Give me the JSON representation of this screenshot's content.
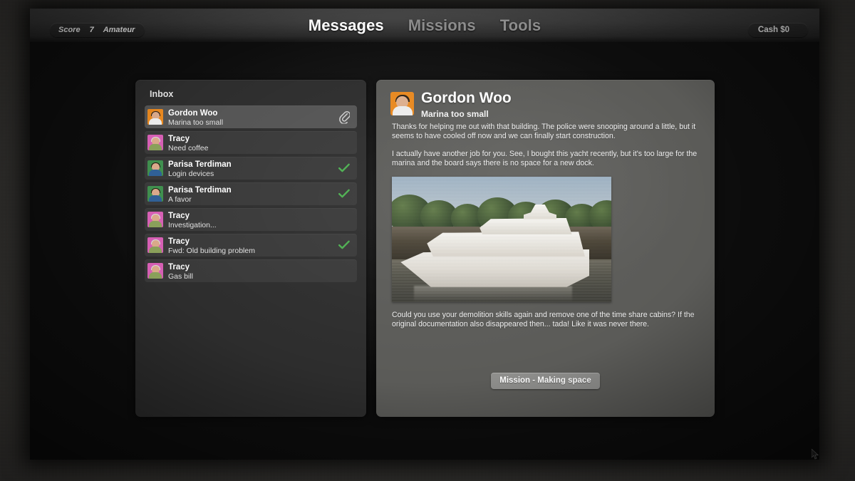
{
  "topbar": {
    "score_label": "Score",
    "score_value": "7",
    "rank": "Amateur",
    "cash": "Cash $0",
    "nav": [
      {
        "label": "Messages",
        "active": true
      },
      {
        "label": "Missions",
        "active": false
      },
      {
        "label": "Tools",
        "active": false
      }
    ]
  },
  "inbox": {
    "title": "Inbox",
    "items": [
      {
        "sender": "Gordon Woo",
        "subject": "Marina too small",
        "selected": true,
        "flag": "attachment-icon",
        "avatar": "gordon"
      },
      {
        "sender": "Tracy",
        "subject": "Need coffee",
        "selected": false,
        "flag": "none",
        "avatar": "tracy"
      },
      {
        "sender": "Parisa Terdiman",
        "subject": "Login devices",
        "selected": false,
        "flag": "check-icon",
        "avatar": "parisa"
      },
      {
        "sender": "Parisa Terdiman",
        "subject": "A favor",
        "selected": false,
        "flag": "check-icon",
        "avatar": "parisa"
      },
      {
        "sender": "Tracy",
        "subject": "Investigation...",
        "selected": false,
        "flag": "none",
        "avatar": "tracy"
      },
      {
        "sender": "Tracy",
        "subject": "Fwd: Old building problem",
        "selected": false,
        "flag": "check-icon",
        "avatar": "tracy"
      },
      {
        "sender": "Tracy",
        "subject": "Gas bill",
        "selected": false,
        "flag": "none",
        "avatar": "tracy"
      }
    ]
  },
  "message": {
    "sender": "Gordon Woo",
    "subject": "Marina too small",
    "paragraph1": "Thanks for helping me out with that building. The police were snooping around a little, but it seems to have cooled off now and we can finally start construction.",
    "paragraph2": "I actually have another job for you. See, I bought this yacht recently, but it's too large for the marina and the board says there is no space for a new dock.",
    "image_alt": "White motor yacht moored beside a stone quay with trees",
    "paragraph3": "Could you use your demolition skills again and remove one of the time share cabins? If the original documentation also disappeared then... tada! Like it was never there.",
    "mission_button": "Mission - Making space"
  },
  "colors": {
    "accent_check": "#4caf50",
    "selected_row": "#545454",
    "row": "#393939",
    "inbox_panel": "#2d2d2d",
    "message_panel": "#5b5b58",
    "mission_button": "#8e8e8c",
    "nav_active": "#ffffff",
    "nav_inactive": "#8c8c8c"
  },
  "avatars": {
    "gordon": {
      "bg": "#e8881f",
      "hair": "#2b2118",
      "body": "#ebebeb"
    },
    "tracy": {
      "bg": "#d65fb4",
      "hair": "#d8d8d8",
      "body": "#8aa05a"
    },
    "parisa": {
      "bg": "#3f8f4e",
      "hair": "#241a12",
      "body": "#2f5f96"
    }
  }
}
